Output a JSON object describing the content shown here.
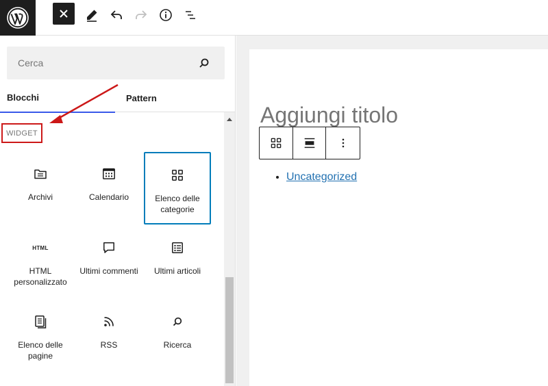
{
  "toolbar": {
    "logo_icon": "wordpress-logo",
    "close_icon": "close-icon",
    "tools_icon": "pencil-icon",
    "undo_icon": "undo-icon",
    "redo_icon": "redo-icon",
    "details_icon": "info-icon",
    "list_view_icon": "list-view-icon"
  },
  "inserter": {
    "search": {
      "placeholder": "Cerca",
      "value": "",
      "icon": "search-icon"
    },
    "tabs": [
      {
        "label": "Blocchi",
        "active": true
      },
      {
        "label": "Pattern",
        "active": false
      }
    ],
    "category_label": "WIDGET",
    "blocks": [
      {
        "label": "Archivi",
        "icon": "folder-icon",
        "selected": false
      },
      {
        "label": "Calendario",
        "icon": "calendar-icon",
        "selected": false
      },
      {
        "label": "Elenco delle categorie",
        "icon": "categories-icon",
        "selected": true
      },
      {
        "label": "HTML personalizzato",
        "icon": "html-icon",
        "icon_text": "HTML",
        "selected": false
      },
      {
        "label": "Ultimi commenti",
        "icon": "comment-icon",
        "selected": false
      },
      {
        "label": "Ultimi articoli",
        "icon": "post-list-icon",
        "selected": false
      },
      {
        "label": "Elenco delle pagine",
        "icon": "pages-icon",
        "selected": false
      },
      {
        "label": "RSS",
        "icon": "rss-icon",
        "selected": false
      },
      {
        "label": "Ricerca",
        "icon": "search-icon",
        "selected": false
      }
    ]
  },
  "editor": {
    "title_placeholder": "Aggiungi titolo",
    "block_toolbar": {
      "block_type_icon": "categories-icon",
      "align_icon": "align-wide-icon",
      "options_icon": "more-vertical-icon"
    },
    "categories": [
      "Uncategorized"
    ]
  },
  "colors": {
    "accent": "#007cba",
    "tab_underline": "#3858e9",
    "annotation_red": "#cc1818",
    "link": "#2271b1",
    "dark": "#1e1e1e"
  }
}
